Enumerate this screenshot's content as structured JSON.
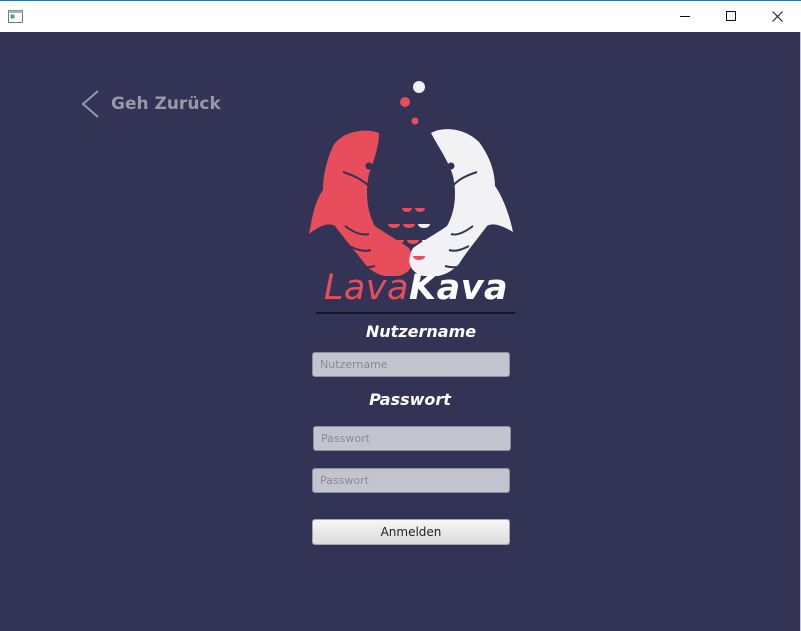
{
  "window": {
    "title": "",
    "controls": {
      "minimize_icon": "minimize-icon",
      "maximize_icon": "maximize-icon",
      "close_icon": "close-icon"
    }
  },
  "nav": {
    "back_label": "Geh Zurück",
    "back_icon": "chevron-left-icon"
  },
  "logo": {
    "icon": "two-fish-logo",
    "brand_part1": "Lava",
    "brand_part2": "Kava",
    "colors": {
      "red": "#e84d5b",
      "white": "#f2f2f4"
    }
  },
  "form": {
    "username_label": "Nutzername",
    "username_placeholder": "Nutzername",
    "password_label": "Passwort",
    "password_placeholder": "Passwort",
    "password_confirm_placeholder": "Passwort",
    "submit_label": "Anmelden"
  },
  "theme": {
    "background": "#333355",
    "back_text": "#9a98a8"
  }
}
